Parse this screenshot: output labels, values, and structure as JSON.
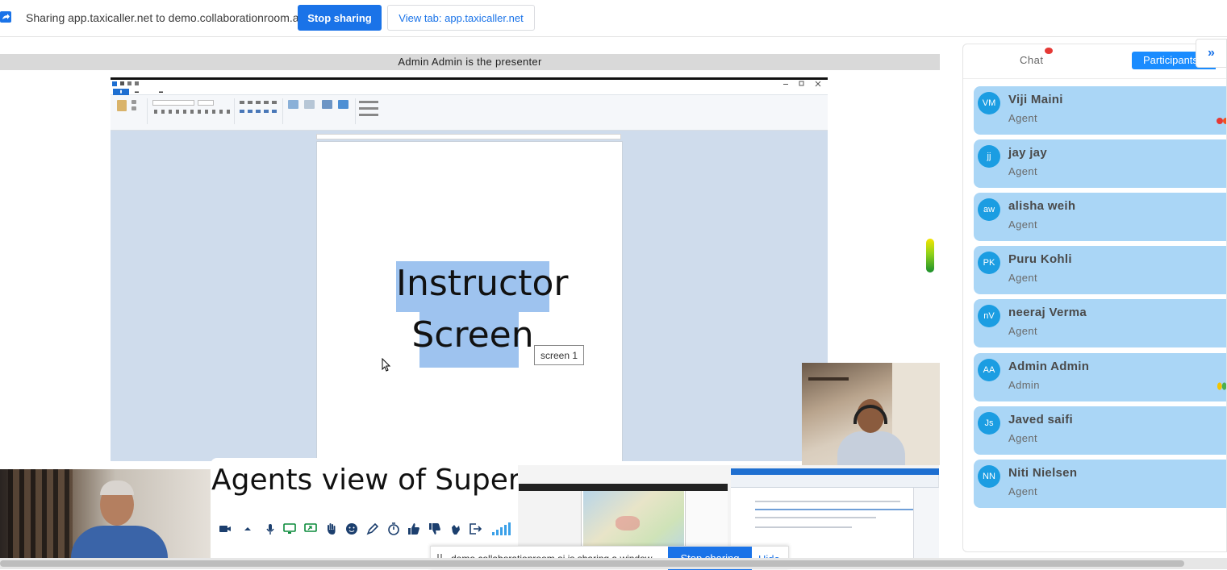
{
  "share_bar": {
    "text": "Sharing app.taxicaller.net to demo.collaborationroom.ai",
    "stop_label": "Stop sharing",
    "view_tab_label": "View tab: app.taxicaller.net"
  },
  "presenter_banner": "Admin Admin is the presenter",
  "shared_screen": {
    "line1": "Instructor",
    "line2": "Screen",
    "tooltip": "screen 1"
  },
  "caption": "Agents view of Supervisor",
  "bottom_share": {
    "text": "demo.collaborationroom.ai is sharing a window.",
    "stop_label": "Stop sharing",
    "hide_label": "Hide"
  },
  "panel": {
    "tab_chat": "Chat",
    "tab_participants": "Participants",
    "collapse_glyph": "»",
    "participants": [
      {
        "initials": "VM",
        "name": "Viji Maini",
        "role": "Agent"
      },
      {
        "initials": "jj",
        "name": "jay jay",
        "role": "Agent"
      },
      {
        "initials": "aw",
        "name": "alisha weih",
        "role": "Agent"
      },
      {
        "initials": "PK",
        "name": "Puru Kohli",
        "role": "Agent"
      },
      {
        "initials": "nV",
        "name": "neeraj Verma",
        "role": "Agent"
      },
      {
        "initials": "AA",
        "name": "Admin Admin",
        "role": "Admin"
      },
      {
        "initials": "Js",
        "name": "Javed saifi",
        "role": "Agent"
      },
      {
        "initials": "NN",
        "name": "Niti Nielsen",
        "role": "Agent"
      }
    ]
  },
  "colors": {
    "accent": "#1a73e8",
    "card_bg": "#aad6f6",
    "avatar_bg": "#1b9de2",
    "selection": "#9ec3ef"
  },
  "toolbar_icons": [
    "camera-icon",
    "caret-up-icon",
    "microphone-icon",
    "screen-share-icon",
    "screen-share-alt-icon",
    "raise-hand-icon",
    "emoji-icon",
    "pen-icon",
    "timer-icon",
    "thumbs-up-icon",
    "thumbs-down-icon",
    "clap-icon",
    "leave-icon",
    "signal-icon"
  ]
}
